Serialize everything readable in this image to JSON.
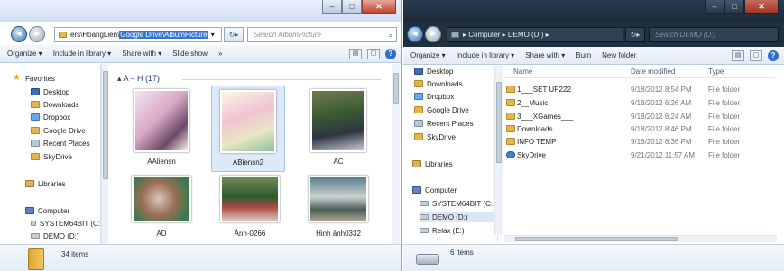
{
  "left": {
    "address": {
      "pre": "ers\\HoangLien\\",
      "selected": "Google Drive\\AlbumPicture",
      "arrow": "▾"
    },
    "search_placeholder": "Search AlbumPicture",
    "toolbar": {
      "organize": "Organize ▾",
      "include": "Include in library ▾",
      "share": "Share with ▾",
      "slideshow": "Slide show",
      "more": "»"
    },
    "nav": {
      "favorites": "Favorites",
      "desktop": "Desktop",
      "downloads": "Downloads",
      "dropbox": "Dropbox",
      "google_drive": "Google Drive",
      "recent": "Recent Places",
      "skydrive": "SkyDrive",
      "libraries": "Libraries",
      "computer": "Computer",
      "system": "SYSTEM64BIT (C:",
      "demo": "DEMO (D:)"
    },
    "group_header": "▴ A – H (17)",
    "thumbs": [
      "AAliensn",
      "ABiensn2",
      "AC",
      "AD",
      "Ảnh-0266",
      "Hinh ảnh0332"
    ],
    "status": "34 items"
  },
  "right": {
    "address": {
      "pre": "▸ Computer ▸ DEMO (D:) ▸"
    },
    "search_placeholder": "Search DEMO (D:)",
    "toolbar": {
      "organize": "Organize ▾",
      "include": "Include in library ▾",
      "share": "Share with ▾",
      "burn": "Burn",
      "newfolder": "New folder"
    },
    "nav": {
      "desktop": "Desktop",
      "downloads": "Downloads",
      "dropbox": "Dropbox",
      "google_drive": "Google Drive",
      "recent": "Recent Places",
      "skydrive": "SkyDrive",
      "libraries": "Libraries",
      "computer": "Computer",
      "system": "SYSTEM64BIT (C:",
      "demo": "DEMO (D:)",
      "relax": "Relax (E:)"
    },
    "columns": {
      "name": "Name",
      "date": "Date modified",
      "type": "Type"
    },
    "files": [
      {
        "name": "1___SET UP222",
        "date": "9/18/2012 8:54 PM",
        "type": "File folder"
      },
      {
        "name": "2__Music",
        "date": "9/18/2012 6:26 AM",
        "type": "File folder"
      },
      {
        "name": "3___XGames___",
        "date": "9/18/2012 6:24 AM",
        "type": "File folder"
      },
      {
        "name": "Downloads",
        "date": "9/18/2012 8:46 PM",
        "type": "File folder"
      },
      {
        "name": "INFO TEMP",
        "date": "9/18/2012 8:36 PM",
        "type": "File folder"
      },
      {
        "name": "SkyDrive",
        "date": "9/21/2012 11:57 AM",
        "type": "File folder"
      }
    ],
    "status": "6 items"
  },
  "colors": {
    "selection": "#3375d6",
    "nav_blue": "#3b6fb0",
    "dark_chrome": "#20303f"
  }
}
